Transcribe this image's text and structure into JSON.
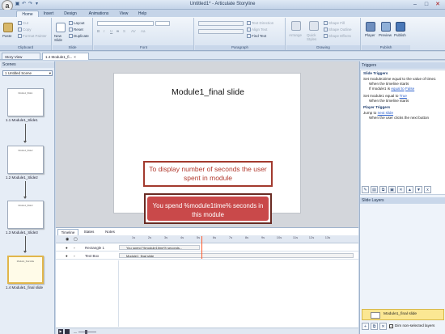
{
  "app": {
    "title": "Untitled1* - Articulate Storyline",
    "logo_letter": "a"
  },
  "quick_access": [
    "save-icon",
    "undo-icon",
    "redo-icon",
    "dropdown-icon"
  ],
  "window_controls": [
    "minimize-icon",
    "maximize-icon",
    "close-icon"
  ],
  "ribbon_tabs": [
    "Home",
    "Insert",
    "Design",
    "Animations",
    "View",
    "Help"
  ],
  "ribbon": {
    "clipboard": {
      "label": "Clipboard",
      "paste": "Paste",
      "cut": "Cut",
      "copy": "Copy",
      "format_painter": "Format Painter"
    },
    "slide": {
      "label": "Slide",
      "new_slide": "New Slide",
      "layout": "Layout",
      "reset": "Reset",
      "duplicate": "Duplicate"
    },
    "font": {
      "label": "Font",
      "bold": "B",
      "italic": "I",
      "underline": "U",
      "strike": "S",
      "shadow": "S",
      "charspacing": "AV",
      "case": "Aa"
    },
    "paragraph": {
      "label": "Paragraph",
      "text_direction": "Text Direction",
      "align_text": "Align Text",
      "find_text": "Find Text"
    },
    "drawing": {
      "label": "Drawing",
      "arrange": "Arrange",
      "quick_styles": "Quick Styles",
      "shape_fill": "Shape Fill",
      "shape_outline": "Shape Outline",
      "shape_effects": "Shape Effects"
    },
    "publish": {
      "label": "Publish",
      "player": "Player",
      "preview": "Preview",
      "publish": "Publish"
    }
  },
  "doc_tabs": {
    "story_view": "Story View",
    "module": "1.4 Module1_fi..."
  },
  "scenes": {
    "header": "Scenes",
    "selected_scene": "1 Untitled Scene",
    "slides": [
      {
        "label": "1.1 Module1_Slide1",
        "thumb_title": "Module1_Slide1"
      },
      {
        "label": "1.2 Module1_Slide2",
        "thumb_title": "Module1_Slide2"
      },
      {
        "label": "1.3 Module1_Slide3",
        "thumb_title": "Module1_Slide3"
      },
      {
        "label": "1.4 Module1_final slide",
        "thumb_title": "Module1_final slide"
      }
    ]
  },
  "slide": {
    "title": "Module1_final slide",
    "annotation": "To display number of seconds the user spent in module",
    "message": "You spend %module1time% seconds in this module"
  },
  "timeline": {
    "tabs": [
      "Timeline",
      "States",
      "Notes"
    ],
    "ticks": [
      "1s",
      "2s",
      "3s",
      "4s",
      "5s",
      "6s",
      "7s",
      "8s",
      "9s",
      "10s",
      "11s",
      "12s",
      "13s"
    ],
    "rows": [
      {
        "name": "Rectangle 1",
        "bar": "You spend %module1time% seconds..."
      },
      {
        "name": "Text Box",
        "bar": "Module1_final slide"
      }
    ]
  },
  "triggers": {
    "header": "Triggers",
    "slide_triggers_heading": "Slide Triggers",
    "lines": [
      "Set module1time equal to the value of time1",
      "When the timeline starts",
      "If module1 is",
      "equal to",
      "False",
      "Set module1 equal to",
      "True",
      "When the timeline starts"
    ],
    "player_triggers_heading": "Player Triggers",
    "jump_to": "Jump to",
    "next_slide": "next slide",
    "when_next": "When the user clicks the next button"
  },
  "slide_layers": {
    "header": "Slide Layers",
    "base_layer": "Module1_final slide",
    "dim_label": "Dim non-selected layers"
  }
}
